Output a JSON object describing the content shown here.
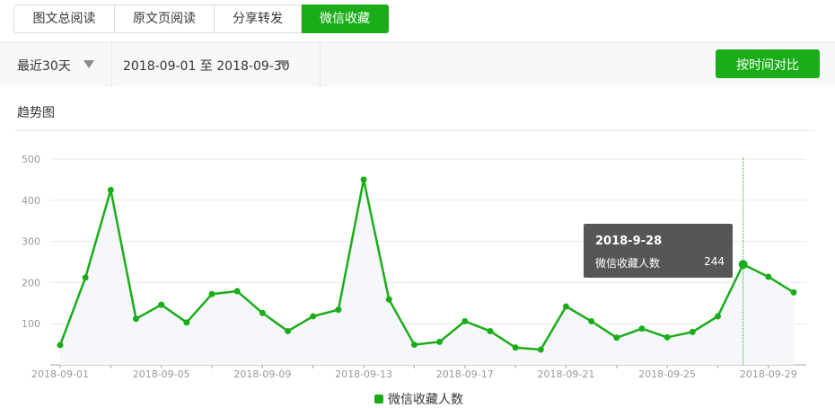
{
  "tabs": [
    {
      "label": "图文总阅读"
    },
    {
      "label": "原文页阅读"
    },
    {
      "label": "分享转发"
    },
    {
      "label": "微信收藏",
      "active": true
    }
  ],
  "filters": {
    "range_label": "最近30天",
    "date_range": "2018-09-01 至 2018-09-30",
    "compare_button": "按时间对比"
  },
  "section": {
    "title": "趋势图"
  },
  "tooltip": {
    "date": "2018-9-28",
    "series_name": "微信收藏人数",
    "value": "244"
  },
  "legend": {
    "label": "微信收藏人数"
  },
  "colors": {
    "accent": "#1aad19",
    "grid": "#e9e9e9",
    "axis": "#aaaaaa"
  },
  "chart_data": {
    "type": "line",
    "x": [
      "2018-09-01",
      "2018-09-02",
      "2018-09-03",
      "2018-09-04",
      "2018-09-05",
      "2018-09-06",
      "2018-09-07",
      "2018-09-08",
      "2018-09-09",
      "2018-09-10",
      "2018-09-11",
      "2018-09-12",
      "2018-09-13",
      "2018-09-14",
      "2018-09-15",
      "2018-09-16",
      "2018-09-17",
      "2018-09-18",
      "2018-09-19",
      "2018-09-20",
      "2018-09-21",
      "2018-09-22",
      "2018-09-23",
      "2018-09-24",
      "2018-09-25",
      "2018-09-26",
      "2018-09-27",
      "2018-09-28",
      "2018-09-29",
      "2018-09-30"
    ],
    "xtick_labels": [
      "2018-09-01",
      "2018-09-05",
      "2018-09-09",
      "2018-09-13",
      "2018-09-17",
      "2018-09-21",
      "2018-09-25",
      "2018-09-29"
    ],
    "yticks": [
      100,
      200,
      300,
      400,
      500
    ],
    "ylim": [
      0,
      500
    ],
    "series": [
      {
        "name": "微信收藏人数",
        "values": [
          48,
          212,
          425,
          112,
          146,
          103,
          172,
          179,
          126,
          82,
          118,
          134,
          450,
          159,
          49,
          56,
          106,
          82,
          42,
          37,
          142,
          106,
          66,
          88,
          67,
          80,
          118,
          244,
          214,
          176
        ]
      }
    ],
    "highlight_index": 27,
    "legend_position": "bottom-center",
    "grid": true
  }
}
